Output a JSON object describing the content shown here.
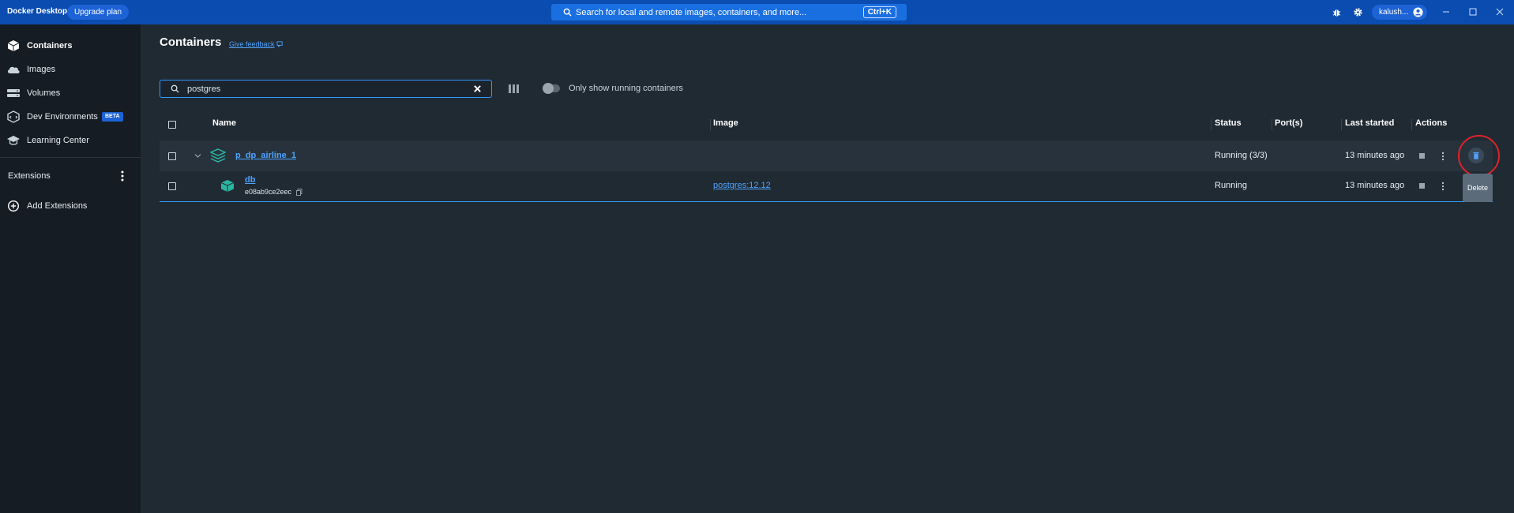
{
  "titlebar": {
    "app_name": "Docker Desktop",
    "upgrade_label": "Upgrade plan",
    "search_placeholder": "Search for local and remote images, containers, and more...",
    "search_shortcut": "Ctrl+K",
    "user_label": "kalush..."
  },
  "sidebar": {
    "items": [
      {
        "label": "Containers",
        "icon": "containers-icon"
      },
      {
        "label": "Images",
        "icon": "cloud-icon"
      },
      {
        "label": "Volumes",
        "icon": "volumes-icon"
      },
      {
        "label": "Dev Environments",
        "icon": "dev-environments-icon",
        "badge": "BETA"
      },
      {
        "label": "Learning Center",
        "icon": "learning-center-icon"
      }
    ],
    "extensions_label": "Extensions",
    "add_extensions_label": "Add Extensions"
  },
  "main": {
    "title": "Containers",
    "feedback_label": "Give feedback",
    "search_value": "postgres",
    "toggle_label": "Only show running containers",
    "columns": [
      "Name",
      "Image",
      "Status",
      "Port(s)",
      "Last started",
      "Actions"
    ],
    "rows": [
      {
        "name": "p_dp_airline_1",
        "id": "",
        "image": "",
        "status": "Running (3/3)",
        "ports": "",
        "last_started": "13 minutes ago"
      },
      {
        "name": "db",
        "id": "e08ab9ce2eec",
        "image": "postgres:12.12",
        "status": "Running",
        "ports": "",
        "last_started": "13 minutes ago"
      }
    ],
    "tooltip": "Delete"
  },
  "colors": {
    "titlebar": "#0b4cb1",
    "sidebar": "#151c23",
    "main": "#202a33",
    "accent": "#2f9bff",
    "highlight_ring": "#e0222a",
    "container_icon": "#2bb5a0"
  }
}
